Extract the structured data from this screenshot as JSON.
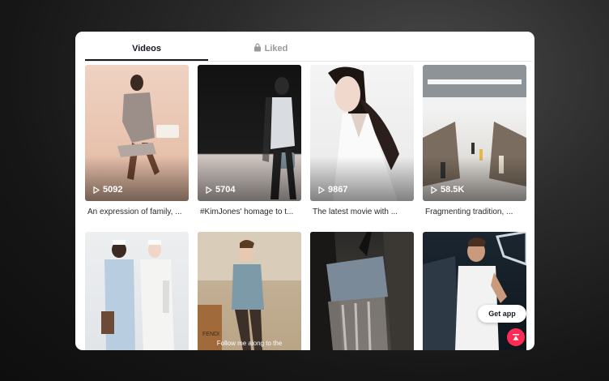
{
  "tabs": {
    "videos": "Videos",
    "liked": "Liked"
  },
  "videos": [
    {
      "views": "5092",
      "caption": "An expression of family, ..."
    },
    {
      "views": "5704",
      "caption": "#KimJones' homage to t..."
    },
    {
      "views": "9867",
      "caption": "The latest movie with ..."
    },
    {
      "views": "58.5K",
      "caption": "Fragmenting tradition, ..."
    },
    {
      "subtitle": "",
      "views": "",
      "caption": ""
    },
    {
      "subtitle": "Follow me along to the",
      "views": "",
      "caption": ""
    }
  ],
  "buttons": {
    "get_app": "Get app"
  },
  "icons": {
    "lock": "lock-icon",
    "play": "play-icon",
    "scroll_top": "scroll-top-icon"
  },
  "colors": {
    "accent": "#fe2c55",
    "text": "#161823",
    "muted": "#9a9a9a"
  }
}
